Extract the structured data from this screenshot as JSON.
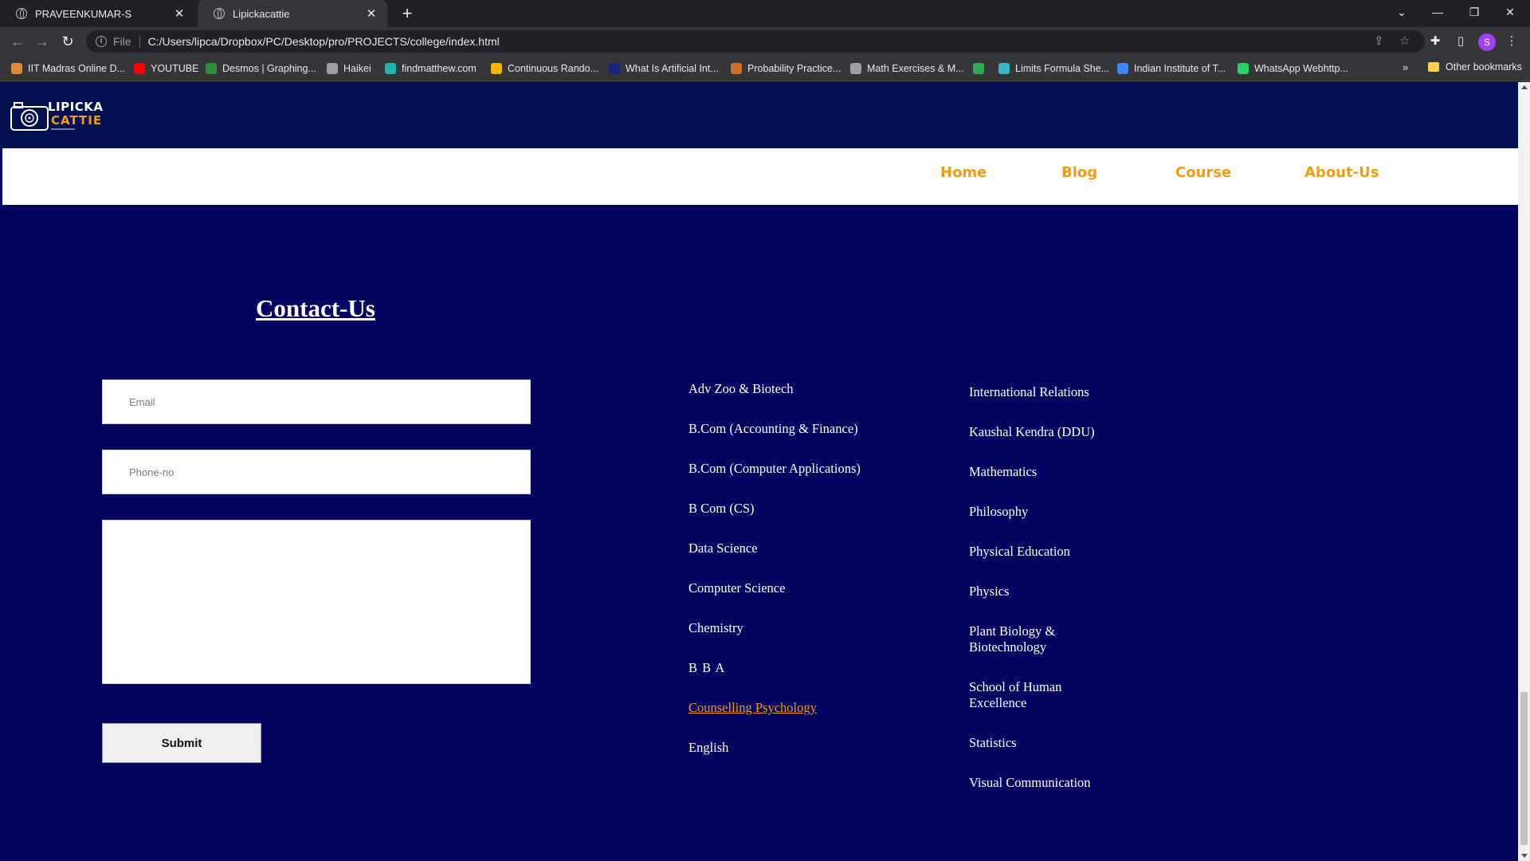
{
  "browser": {
    "tabs": [
      {
        "title": "PRAVEENKUMAR-S",
        "active": false
      },
      {
        "title": "Lipickacattie",
        "active": true
      }
    ],
    "address": {
      "scheme": "File",
      "url": "C:/Users/lipca/Dropbox/PC/Desktop/pro/PROJECTS/college/index.html"
    },
    "profile_initial": "S",
    "bookmarks": [
      {
        "label": "IIT Madras Online D...",
        "icon_color": "#e0873a"
      },
      {
        "label": "YOUTUBE",
        "icon_color": "#ff0000"
      },
      {
        "label": "Desmos | Graphing...",
        "icon_color": "#2e8b3a"
      },
      {
        "label": "Haikei",
        "icon_color": "#9aa0a6"
      },
      {
        "label": "findmatthew.com",
        "icon_color": "#1fb5a7"
      },
      {
        "label": "Continuous Rando...",
        "icon_color": "#f4b400"
      },
      {
        "label": "What Is Artificial Int...",
        "icon_color": "#1a237e"
      },
      {
        "label": "Probability Practice...",
        "icon_color": "#c8702b"
      },
      {
        "label": "Math Exercises & M...",
        "icon_color": "#9aa0a6"
      },
      {
        "label": "",
        "icon_color": "#34a853"
      },
      {
        "label": "Limits Formula She...",
        "icon_color": "#3bb6c5"
      },
      {
        "label": "Indian Institute of T...",
        "icon_color": "#4285f4"
      },
      {
        "label": "WhatsApp Webhttp...",
        "icon_color": "#25d366"
      }
    ],
    "other_bookmarks": "Other bookmarks",
    "more": "»"
  },
  "site": {
    "logo": {
      "line1": "LIPICKA",
      "line2": "CATTIE"
    },
    "nav": [
      "Home",
      "Blog",
      "Course",
      "About-Us"
    ],
    "colors": {
      "accent": "#f39c12",
      "page_bg": "#050561",
      "header_bg": "#020f4e"
    }
  },
  "contact": {
    "title": "Contact-Us",
    "email_placeholder": "Email",
    "phone_placeholder": "Phone-no",
    "message_value": "",
    "submit_label": "Submit"
  },
  "courses_col1": [
    {
      "label": "Adv Zoo & Biotech",
      "link": false
    },
    {
      "label": "B.Com (Accounting & Finance)",
      "link": false
    },
    {
      "label": "B.Com (Computer Applications)",
      "link": false
    },
    {
      "label": "B Com (CS)",
      "link": false
    },
    {
      "label": "Data Science",
      "link": false
    },
    {
      "label": "Computer Science",
      "link": false
    },
    {
      "label": "Chemistry",
      "link": false
    },
    {
      "label": "B B A",
      "link": false
    },
    {
      "label": "Counselling Psychology",
      "link": true
    },
    {
      "label": "English",
      "link": false
    }
  ],
  "courses_col2": [
    {
      "label": "International Relations"
    },
    {
      "label": "Kaushal Kendra (DDU)"
    },
    {
      "label": "Mathematics"
    },
    {
      "label": "Philosophy"
    },
    {
      "label": "Physical Education"
    },
    {
      "label": "Physics"
    },
    {
      "label": "Plant Biology & Biotechnology"
    },
    {
      "label": "School of Human Excellence"
    },
    {
      "label": "Statistics"
    },
    {
      "label": "Visual Communication"
    }
  ]
}
